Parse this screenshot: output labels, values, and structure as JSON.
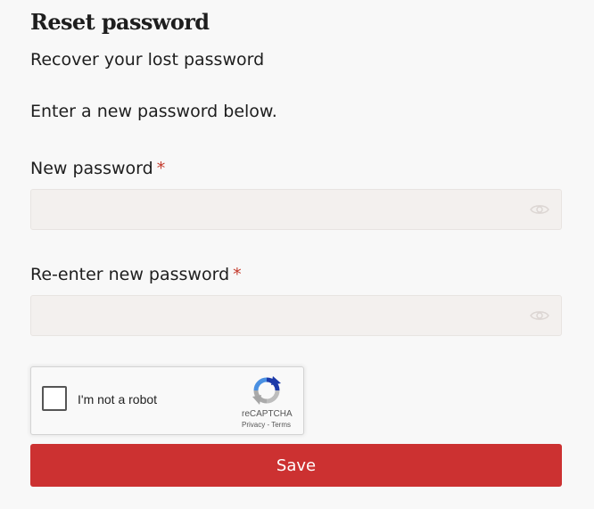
{
  "page": {
    "title": "Reset password",
    "subtitle": "Recover your lost password",
    "instructions": "Enter a new password below."
  },
  "form": {
    "new_password": {
      "label": "New password",
      "required_marker": "*",
      "value": "",
      "placeholder": "",
      "toggle_icon": "eye-icon"
    },
    "confirm_password": {
      "label": "Re-enter new password",
      "required_marker": "*",
      "value": "",
      "placeholder": "",
      "toggle_icon": "eye-icon"
    },
    "recaptcha": {
      "label": "I'm not a robot",
      "brand": "reCAPTCHA",
      "privacy_link": "Privacy",
      "separator": "-",
      "terms_link": "Terms",
      "checked": false
    },
    "save_label": "Save"
  },
  "colors": {
    "background": "#f8f8f8",
    "input_background": "#f3f0ee",
    "required_marker": "#c43a2c",
    "save_button": "#cc3131",
    "save_button_text": "#ffffff"
  }
}
